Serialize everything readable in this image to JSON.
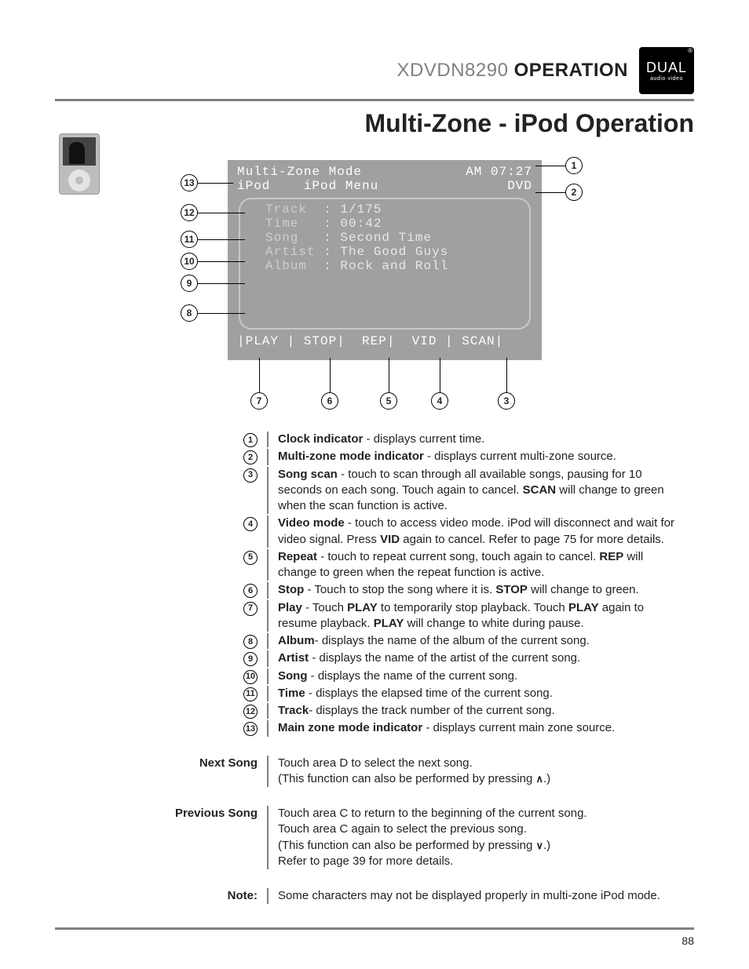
{
  "header": {
    "model": "XDVDN8290",
    "operation": "OPERATION"
  },
  "logo": {
    "brand": "DUAL",
    "sub": "audio·video"
  },
  "section_title": "Multi-Zone - iPod Operation",
  "screen": {
    "mode_title": "Multi-Zone Mode",
    "clock": "AM 07:27",
    "zone_left": "iPod",
    "zone_mid": "iPod Menu",
    "zone_right": "DVD",
    "rows": {
      "track_label": "Track",
      "track_value": "1/175",
      "time_label": "Time",
      "time_value": "00:42",
      "song_label": "Song",
      "song_value": "Second Time",
      "artist_label": "Artist",
      "artist_value": "The Good Guys",
      "album_label": "Album",
      "album_value": "Rock and Roll"
    },
    "bottom_bar": "|PLAY | STOP|  REP|  VID | SCAN|"
  },
  "diagram_callouts_left": [
    "13",
    "12",
    "11",
    "10",
    "9",
    "8"
  ],
  "diagram_callouts_right": [
    "1",
    "2"
  ],
  "diagram_callouts_bottom": [
    "7",
    "6",
    "5",
    "4",
    "3"
  ],
  "legend": [
    {
      "n": "1",
      "bold": "Clock indicator",
      "rest": " - displays current time."
    },
    {
      "n": "2",
      "bold": "Multi-zone mode indicator",
      "rest": "  - displays current multi-zone source."
    },
    {
      "n": "3",
      "bold": "Song scan",
      "rest": " - touch to scan through all available songs, pausing for 10 seconds on each song. Touch again to cancel. ",
      "bold2": "SCAN",
      "rest2": " will change to green when the scan function is active."
    },
    {
      "n": "4",
      "bold": "Video mode",
      "rest": " - touch to access video mode. iPod will disconnect and wait for video signal. Press ",
      "bold2": "VID",
      "rest2": " again to cancel. Refer to page 75 for more details."
    },
    {
      "n": "5",
      "bold": "Repeat",
      "rest": " - touch to repeat current song, touch again to cancel. ",
      "bold2": "REP",
      "rest2": " will change to green when the repeat function is active."
    },
    {
      "n": "6",
      "bold": "Stop",
      "rest": " - Touch to stop the song where it is. ",
      "bold2": "STOP",
      "rest2": " will change to green."
    },
    {
      "n": "7",
      "bold": "Play",
      "rest": " - Touch ",
      "bold2": "PLAY",
      "rest2": " to temporarily stop playback. Touch ",
      "bold3": "PLAY",
      "rest3": " again to resume playback. ",
      "bold4": "PLAY",
      "rest4": " will change to white during pause."
    },
    {
      "n": "8",
      "bold": "Album",
      "rest": "- displays the name of the album of the current song."
    },
    {
      "n": "9",
      "bold": "Artist",
      "rest": " - displays the name of the artist of the current song."
    },
    {
      "n": "10",
      "bold": "Song",
      "rest": " - displays the name of the current song."
    },
    {
      "n": "11",
      "bold": "Time",
      "rest": " - displays the elapsed time of the current song."
    },
    {
      "n": "12",
      "bold": "Track",
      "rest": "- displays the track number of the current song."
    },
    {
      "n": "13",
      "bold": "Main zone mode indicator",
      "rest": " - displays current main zone source."
    }
  ],
  "next_song": {
    "label": "Next Song",
    "line1": "Touch area D to select the next song.",
    "line2_a": "(This function can also be performed by pressing ",
    "line2_b": ".)"
  },
  "prev_song": {
    "label": "Previous Song",
    "line1": "Touch area C to return to the beginning of the current song.",
    "line2": "Touch area C again to select the previous song.",
    "line3_a": "(This function can also be performed by pressing ",
    "line3_b": ".)",
    "line4": "Refer to page 39 for more details."
  },
  "note": {
    "label": "Note:",
    "text": "Some characters may not be displayed properly in multi-zone iPod mode."
  },
  "page_number": "88"
}
